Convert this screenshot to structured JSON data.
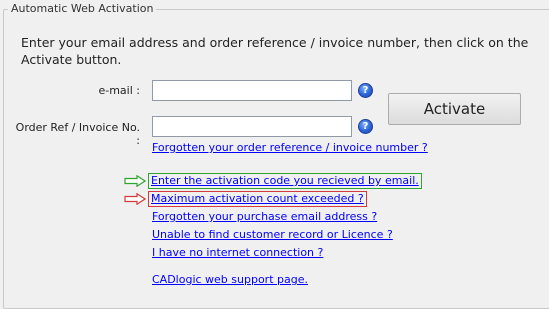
{
  "group": {
    "title": "Automatic Web Activation"
  },
  "instructions": "Enter your email address and order reference / invoice number, then click on the Activate button.",
  "fields": {
    "email_label": "e-mail :",
    "email_value": "",
    "order_label": "Order Ref / Invoice No. :",
    "order_value": ""
  },
  "help_glyph": "?",
  "activate_label": "Activate",
  "links": {
    "forgotten_order_ref": "Forgotten your order reference / invoice number ?",
    "enter_activation_code": "Enter the activation code you recieved by email.",
    "max_activation_count": "Maximum activation count exceeded ?",
    "forgotten_email": "Forgotten your purchase email address ?",
    "no_customer_record": "Unable to find customer record or Licence ?",
    "no_internet": "I have no internet connection ?",
    "support_page": "CADlogic web support page."
  },
  "colors": {
    "link": "#0000ff",
    "green_highlight": "#2fa52f",
    "red_highlight": "#d43a3a"
  },
  "icons": [
    "help-icon",
    "green-arrow-icon",
    "red-arrow-icon"
  ]
}
